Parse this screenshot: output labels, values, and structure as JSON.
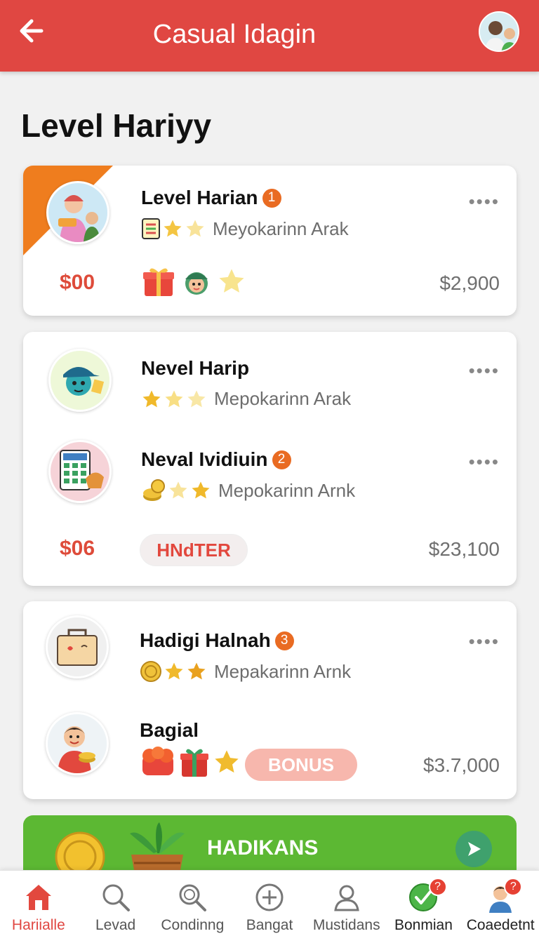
{
  "header": {
    "title": "Casual Idagin",
    "back_icon": "arrow-left-icon",
    "avatar_icon": "user-avatar-icon",
    "color": "#e04742"
  },
  "page_title": "Level Hariyy",
  "cards": [
    {
      "items": [
        {
          "title": "Level Harian",
          "badge": "1",
          "subtitle": "Meyokarinn Arak",
          "icon": "mother-child-icon"
        }
      ],
      "price_left": "$00",
      "price_right": "$2,900",
      "accent": "#ef7d1e"
    },
    {
      "items": [
        {
          "title": "Nevel Harip",
          "badge": "",
          "subtitle": "Mepokarinn Arak",
          "icon": "cap-kid-icon"
        },
        {
          "title": "Neval Ividiuin",
          "badge": "2",
          "subtitle": "Mepokarinn Arnk",
          "icon": "calculator-food-icon"
        }
      ],
      "price_left": "$06",
      "tag": "HNdTER",
      "price_right": "$23,100"
    },
    {
      "items": [
        {
          "title": "Hadigi Halnah",
          "badge": "3",
          "subtitle": "Mepakarinn Arnk",
          "icon": "suitcase-icon"
        },
        {
          "title": "Bagial",
          "badge": "",
          "subtitle": "",
          "icon": "boy-coins-icon"
        }
      ],
      "tag": "BONUS",
      "price_right": "$3.7,000"
    }
  ],
  "more_label": "••••",
  "banner": {
    "title": "HADIKANS",
    "color": "#5cb833",
    "play_icon": "play-icon"
  },
  "nav": [
    {
      "label": "Hariialle",
      "icon": "home-icon",
      "badge": ""
    },
    {
      "label": "Levad",
      "icon": "search-icon",
      "badge": ""
    },
    {
      "label": "Condinng",
      "icon": "search-icon",
      "badge": ""
    },
    {
      "label": "Bangat",
      "icon": "plus-circle-icon",
      "badge": ""
    },
    {
      "label": "Mustidans",
      "icon": "user-icon",
      "badge": ""
    },
    {
      "label": "Bonmian",
      "icon": "check-circle-icon",
      "badge": "?"
    },
    {
      "label": "Coaedetnt",
      "icon": "profile-icon",
      "badge": "?"
    }
  ]
}
